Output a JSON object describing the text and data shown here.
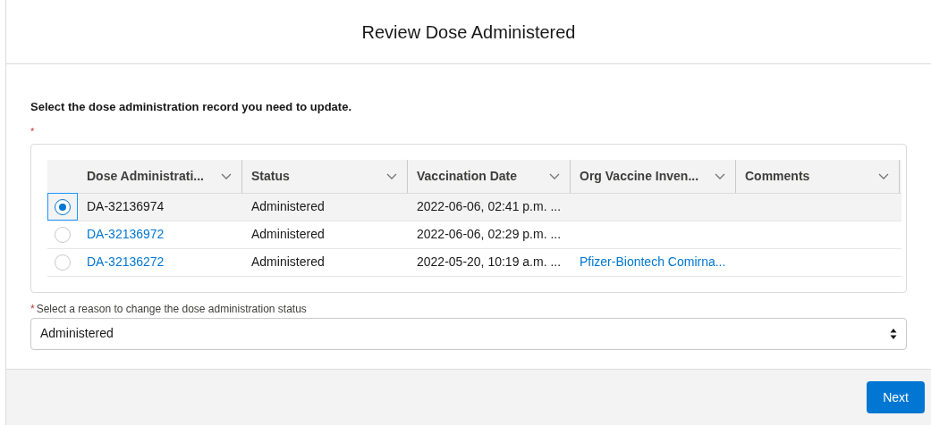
{
  "modal": {
    "title": "Review Dose Administered"
  },
  "instruction": "Select the dose administration record you need to update.",
  "required_mark": "*",
  "table": {
    "columns": [
      {
        "label": "Dose Administrati..."
      },
      {
        "label": "Status"
      },
      {
        "label": "Vaccination Date"
      },
      {
        "label": "Org Vaccine Inven..."
      },
      {
        "label": "Comments"
      }
    ],
    "rows": [
      {
        "selected": true,
        "dose_administration": "DA-32136974",
        "status": "Administered",
        "vaccination_date": "2022-06-06, 02:41 p.m. ..."
      },
      {
        "selected": false,
        "dose_administration": "DA-32136972",
        "status": "Administered",
        "vaccination_date": "2022-06-06, 02:29 p.m. ..."
      },
      {
        "selected": false,
        "dose_administration": "DA-32136272",
        "status": "Administered",
        "vaccination_date": "2022-05-20, 10:19 a.m. ...",
        "org_vaccine_inventory": "Pfizer-Biontech Comirna..."
      }
    ]
  },
  "reason_field": {
    "required_mark": "*",
    "label": "Select a reason to change the dose administration status",
    "value": "Administered"
  },
  "footer": {
    "buttons": [
      "Next"
    ]
  }
}
